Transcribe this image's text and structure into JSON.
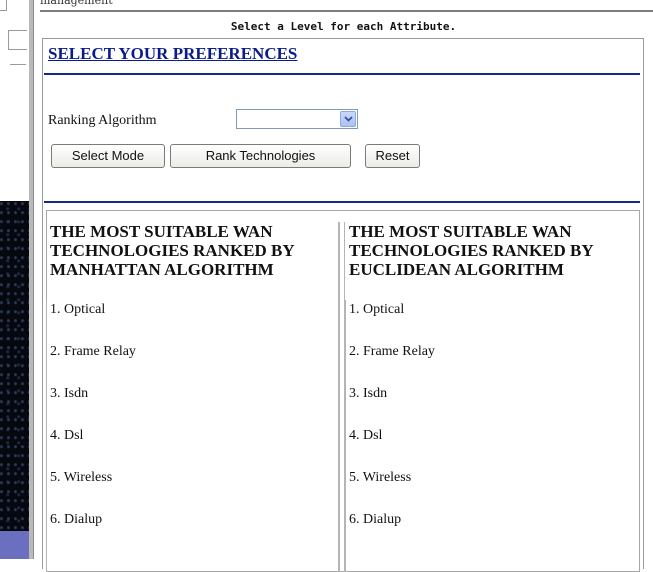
{
  "page": {
    "top_fragment": "management",
    "banner": "Select a Level for each Attribute."
  },
  "preferences": {
    "title": "SELECT YOUR PREFERENCES",
    "ranking_label": "Ranking Algorithm",
    "ranking_selected": "",
    "buttons": {
      "select_mode": "Select Mode",
      "rank_technologies": "Rank Technologies",
      "reset": "Reset"
    }
  },
  "results": {
    "manhattan": {
      "heading": "THE MOST SUITABLE WAN TECHNOLOGIES RANKED BY MANHATTAN ALGORITHM",
      "items": [
        "1. Optical",
        "2. Frame Relay",
        "3. Isdn",
        "4. Dsl",
        "5. Wireless",
        "6. Dialup"
      ]
    },
    "euclidean": {
      "heading": "THE MOST SUITABLE WAN TECHNOLOGIES RANKED BY EUCLIDEAN ALGORITHM",
      "items": [
        "1. Optical",
        "2. Frame Relay",
        "3. Isdn",
        "4. Dsl",
        "5. Wireless",
        "6. Dialup"
      ]
    }
  },
  "icons": {
    "dropdown": "chevron-down-icon"
  },
  "colors": {
    "link_title": "#0a1c8c",
    "rule": "#142a8a"
  }
}
